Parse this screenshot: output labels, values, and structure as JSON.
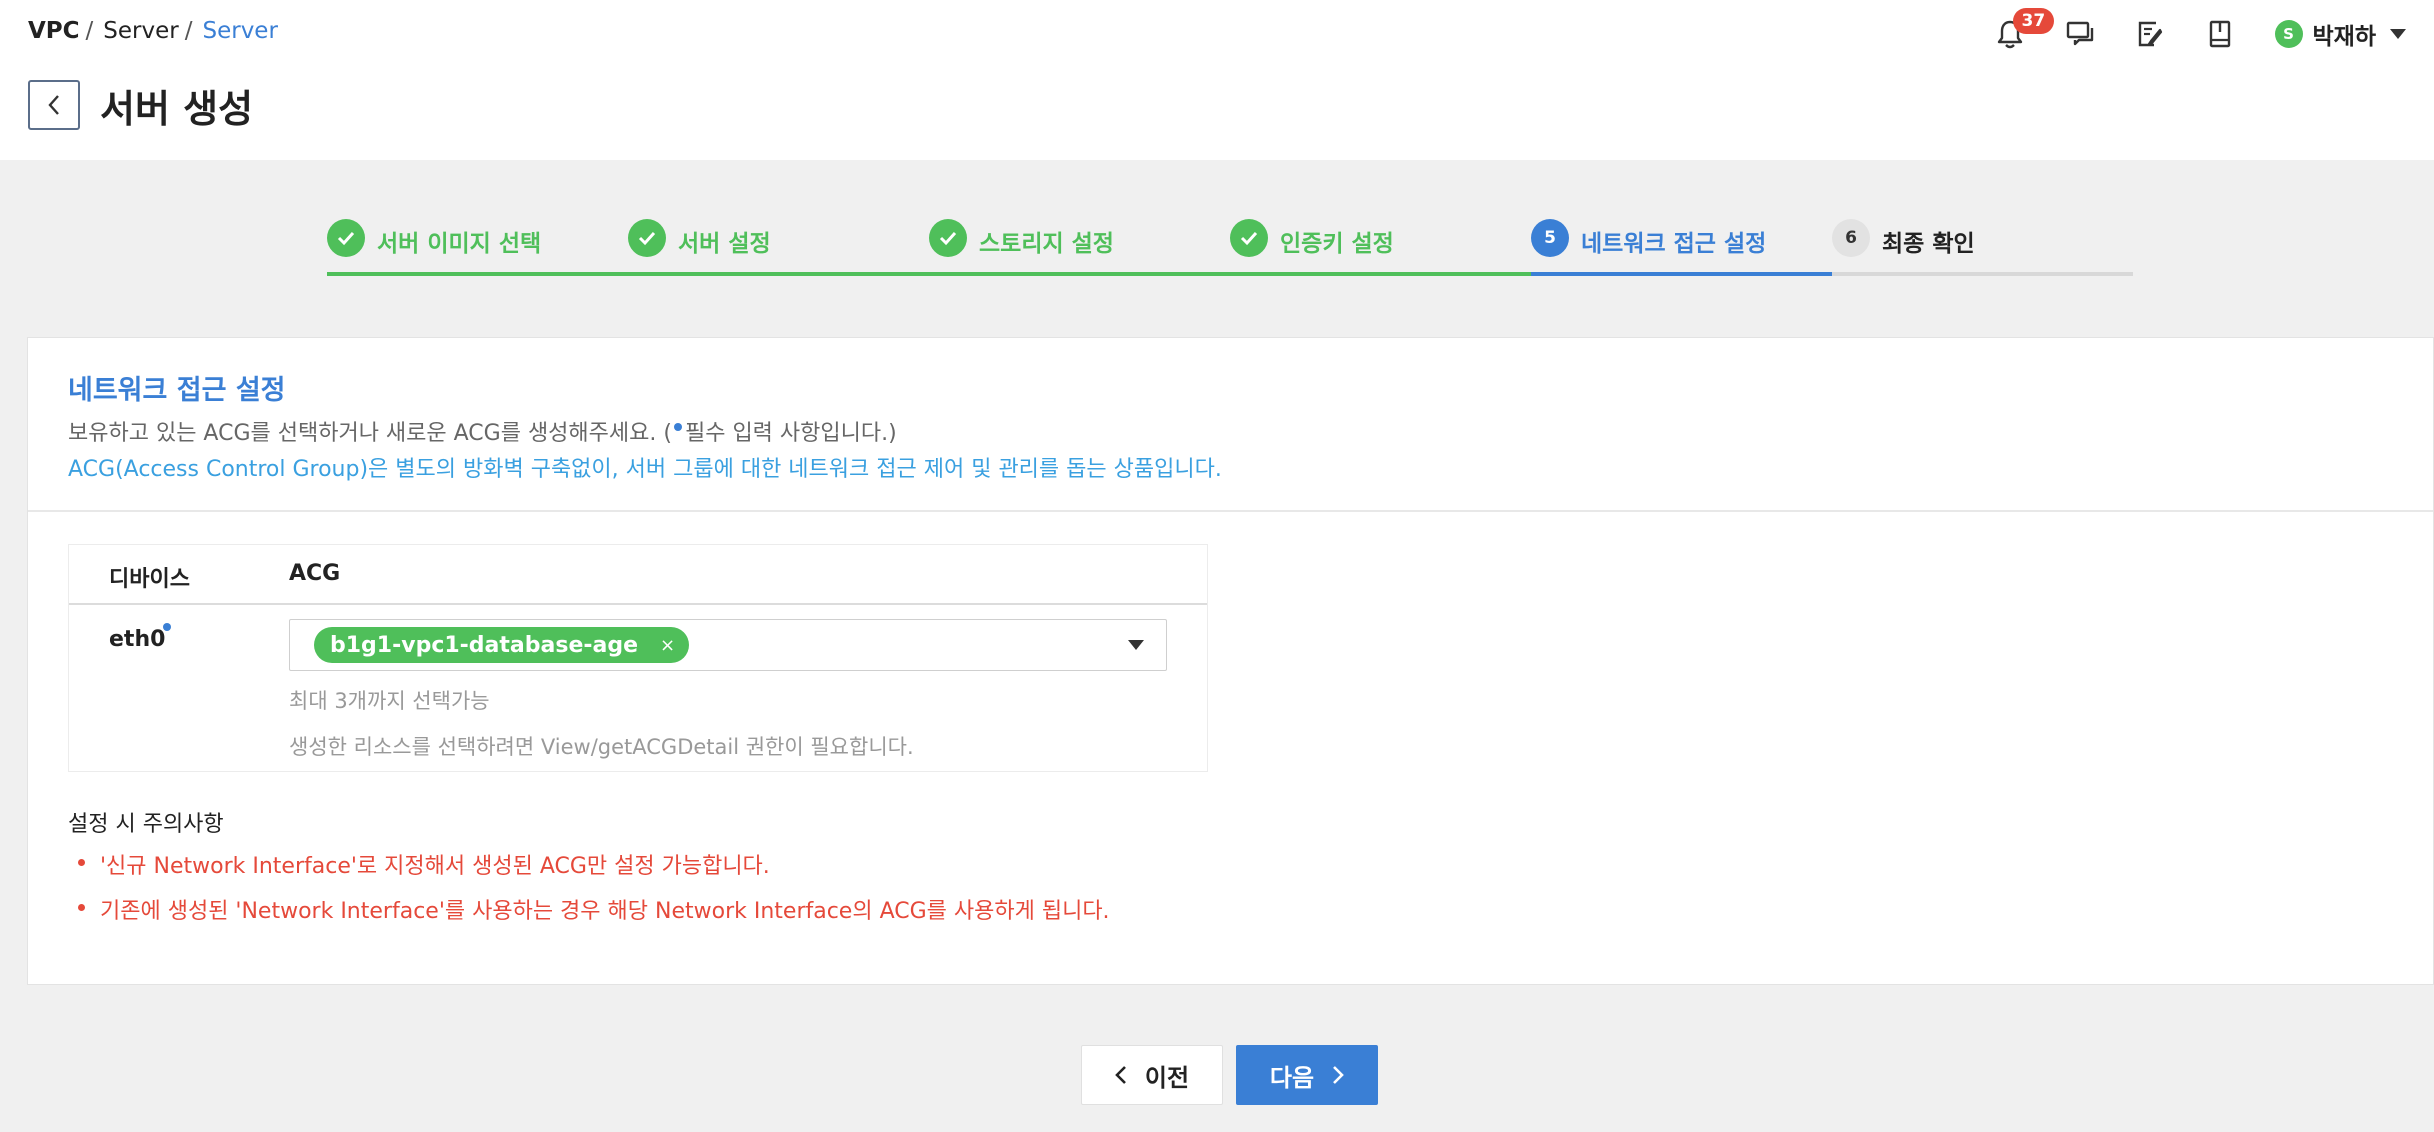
{
  "breadcrumb": [
    "VPC",
    "Server",
    "Server"
  ],
  "page_title": "서버 생성",
  "notifications": {
    "count": "37"
  },
  "user": {
    "initial": "S",
    "name": "박재하"
  },
  "steps": [
    {
      "label": "서버 이미지 선택",
      "state": "done"
    },
    {
      "label": "서버 설정",
      "state": "done"
    },
    {
      "label": "스토리지 설정",
      "state": "done"
    },
    {
      "label": "인증키 설정",
      "state": "done"
    },
    {
      "label": "네트워크 접근 설정",
      "state": "current",
      "number": "5"
    },
    {
      "label": "최종 확인",
      "state": "todo",
      "number": "6"
    }
  ],
  "section": {
    "title": "네트워크 접근 설정",
    "desc1_before": "보유하고 있는 ACG를 선택하거나 새로운 ACG를 생성해주세요. (",
    "desc1_after": "필수 입력 사항입니다.)",
    "desc2": "ACG(Access Control Group)은 별도의 방화벽 구축없이, 서버 그룹에 대한 네트워크 접근 제어 및 관리를 돕는 상품입니다."
  },
  "table": {
    "col_device": "디바이스",
    "col_acg": "ACG",
    "device": "eth0",
    "selected_acg": "b1g1-vpc1-database-age",
    "tag_remove": "×",
    "hint_max": "최대 3개까지 선택가능",
    "hint_permission": "생성한 리소스를 선택하려면 View/getACGDetail 권한이 필요합니다."
  },
  "notes": {
    "title": "설정 시 주의사항",
    "items": [
      "'신규 Network Interface'로 지정해서 생성된 ACG만 설정 가능합니다.",
      "기존에 생성된 'Network Interface'를 사용하는 경우 해당 Network Interface의 ACG를 사용하게 됩니다."
    ]
  },
  "buttons": {
    "prev": "이전",
    "next": "다음"
  },
  "colors": {
    "primary": "#3a7fd5",
    "success": "#4fbf5a",
    "danger": "#e5493a"
  }
}
